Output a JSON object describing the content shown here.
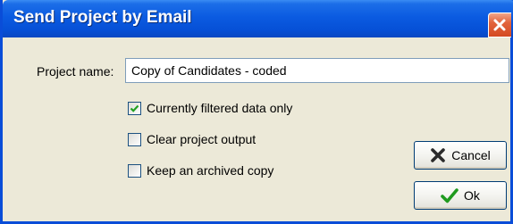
{
  "window": {
    "title": "Send Project by Email"
  },
  "form": {
    "project_name_label": "Project name:",
    "project_name_value": "Copy of Candidates - coded"
  },
  "options": [
    {
      "label": "Currently filtered data only",
      "checked": true
    },
    {
      "label": "Clear project output",
      "checked": false
    },
    {
      "label": "Keep an archived copy",
      "checked": false
    }
  ],
  "buttons": {
    "cancel_label": "Cancel",
    "ok_label": "Ok"
  },
  "colors": {
    "titlebar": "#0b5be1",
    "dialog_background": "#ece9d8",
    "cancel_icon": "#2b2b2b",
    "ok_icon": "#1f9a1f",
    "close_button": "#d44a22"
  },
  "icons": {
    "close": "close-icon",
    "cancel": "x-mark-icon",
    "ok": "check-mark-icon",
    "checkbox_checked": "checkmark-icon"
  }
}
